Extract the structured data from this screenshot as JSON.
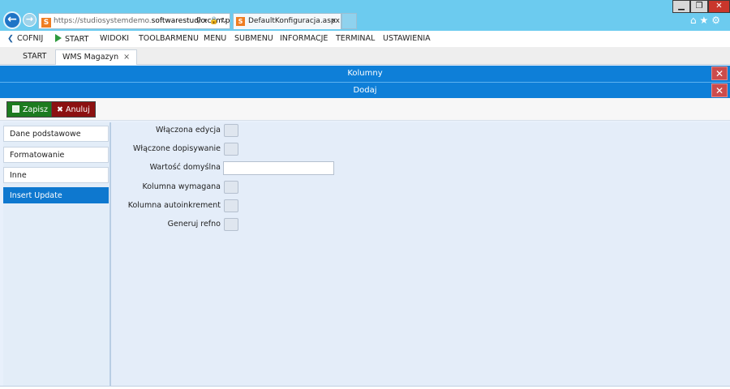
{
  "browser": {
    "address_prefix": "https://studiosystemdemo.",
    "address_domain": "softwarestudio.com.pl",
    "address_suffix": "/",
    "tab_title": "DefaultKonfiguracja.aspx",
    "tab_close": "×",
    "window_minimize": "▁",
    "window_restore": "❐",
    "window_close": "✕",
    "icons": [
      "home-icon",
      "star-icon",
      "gear-icon"
    ]
  },
  "menu": {
    "back_label": "COFNIJ",
    "start_label": "START",
    "items": [
      "WIDOKI",
      "TOOLBARMENU",
      "MENU",
      "SUBMENU",
      "INFORMACJE",
      "TERMINAL",
      "USTAWIENIA"
    ]
  },
  "tabs": {
    "start_label": "START",
    "active_label": "WMS Magazyn",
    "close": "×"
  },
  "dialogs": {
    "columns_title": "Kolumny",
    "add_title": "Dodaj",
    "close_symbol": "✕"
  },
  "toolbar": {
    "save_label": "Zapisz",
    "cancel_label": "Anuluj"
  },
  "sidebar": {
    "items": [
      {
        "label": "Dane podstawowe",
        "active": false
      },
      {
        "label": "Formatowanie",
        "active": false
      },
      {
        "label": "Inne",
        "active": false
      },
      {
        "label": "Insert Update",
        "active": true
      }
    ]
  },
  "form": {
    "fields": [
      {
        "label": "Włączona edycja",
        "type": "checkbox",
        "checked": false
      },
      {
        "label": "Włączone dopisywanie",
        "type": "checkbox",
        "checked": false
      },
      {
        "label": "Wartość domyślna",
        "type": "text",
        "value": ""
      },
      {
        "label": "Kolumna wymagana",
        "type": "checkbox",
        "checked": false
      },
      {
        "label": "Kolumna autoinkrement",
        "type": "checkbox",
        "checked": false
      },
      {
        "label": "Generuj refno",
        "type": "checkbox",
        "checked": false
      }
    ]
  },
  "colors": {
    "accent_blue": "#0e7fd8",
    "save_green": "#1d7b1f",
    "cancel_red": "#8c1111",
    "titlebar": "#6ccbef"
  }
}
